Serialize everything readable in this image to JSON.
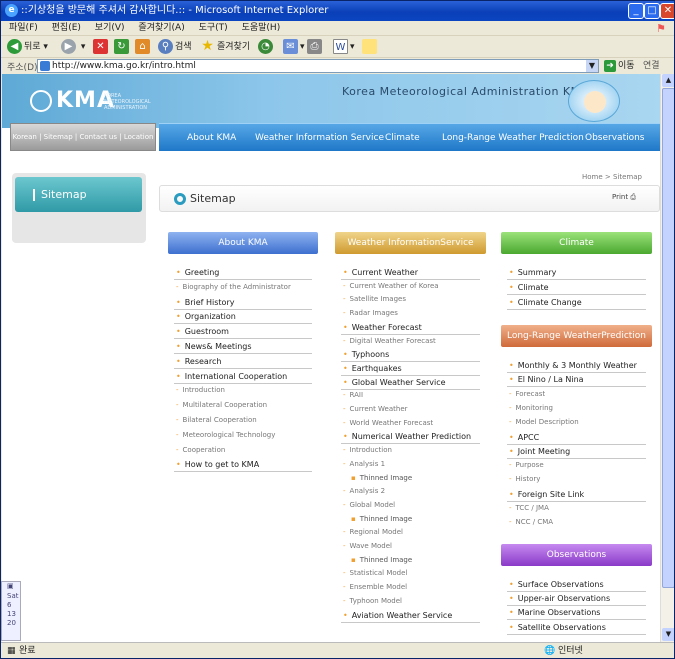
{
  "window": {
    "title": "::기상청을 방문해 주셔서 감사합니다.:: - Microsoft Internet Explorer",
    "controls": [
      "_",
      "□",
      "✕"
    ]
  },
  "menubar": [
    "파일(F)",
    "편집(E)",
    "보기(V)",
    "즐겨찾기(A)",
    "도구(T)",
    "도움말(H)"
  ],
  "toolbar": {
    "back": "뒤로",
    "search": "검색",
    "favorites": "즐겨찾기"
  },
  "address": {
    "label": "주소(D)",
    "url": "http://www.kma.go.kr/intro.html",
    "go": "이동",
    "links": "연결"
  },
  "status": {
    "left": "완료",
    "right": "인터넷"
  },
  "taskbar_fragments": [
    "Sat",
    "6",
    "13",
    "20"
  ],
  "site": {
    "logo": "KMA",
    "logo_sub": "KOREA METEOROLOGICAL ADMINISTRATION",
    "header_title": "Korea Meteorological Administration KMA",
    "side_nav": [
      "Korean",
      "Sitemap",
      "Contact us",
      "Location"
    ],
    "main_nav": [
      "About KMA",
      "Weather Information Service",
      "Climate",
      "Long-Range Weather Prediction",
      "Observations"
    ],
    "sidebar_title": "Sitemap",
    "breadcrumb": "Home > Sitemap",
    "page_title": "Sitemap",
    "print": "Print"
  },
  "sitemap": {
    "about": {
      "header": "About KMA",
      "items": [
        {
          "t": "Greeting",
          "k": "main"
        },
        {
          "t": "Biography of the Administrator",
          "k": "sub"
        },
        {
          "t": "Brief History",
          "k": "main"
        },
        {
          "t": "Organization",
          "k": "main"
        },
        {
          "t": "Guestroom",
          "k": "main"
        },
        {
          "t": "News& Meetings",
          "k": "main"
        },
        {
          "t": "Research",
          "k": "main"
        },
        {
          "t": "International Cooperation",
          "k": "main"
        },
        {
          "t": "Introduction",
          "k": "sub"
        },
        {
          "t": "Multilateral Cooperation",
          "k": "sub"
        },
        {
          "t": "Bilateral Cooperation",
          "k": "sub"
        },
        {
          "t": "Meteorological Technology",
          "k": "sub"
        },
        {
          "t": "Cooperation",
          "k": "sub"
        },
        {
          "t": "How to get to KMA",
          "k": "main"
        }
      ]
    },
    "weather": {
      "header": "Weather InformationService",
      "items": [
        {
          "t": "Current Weather",
          "k": "main"
        },
        {
          "t": "Current Weather of Korea",
          "k": "sub"
        },
        {
          "t": "Satellite Images",
          "k": "sub"
        },
        {
          "t": "Radar Images",
          "k": "sub"
        },
        {
          "t": "Weather Forecast",
          "k": "main"
        },
        {
          "t": "Digital Weather Forecast",
          "k": "sub"
        },
        {
          "t": "Typhoons",
          "k": "main"
        },
        {
          "t": "Earthquakes",
          "k": "main"
        },
        {
          "t": "Global Weather Service",
          "k": "main"
        },
        {
          "t": "RAII",
          "k": "sub"
        },
        {
          "t": "Current Weather",
          "k": "sub"
        },
        {
          "t": "World Weather Forecast",
          "k": "sub"
        },
        {
          "t": "Numerical Weather Prediction",
          "k": "main"
        },
        {
          "t": "Introduction",
          "k": "sub"
        },
        {
          "t": "Analysis 1",
          "k": "sub"
        },
        {
          "t": "Thinned Image",
          "k": "sub2"
        },
        {
          "t": "Analysis 2",
          "k": "sub"
        },
        {
          "t": "Global Model",
          "k": "sub"
        },
        {
          "t": "Thinned Image",
          "k": "sub2"
        },
        {
          "t": "Regional Model",
          "k": "sub"
        },
        {
          "t": "Wave Model",
          "k": "sub"
        },
        {
          "t": "Thinned Image",
          "k": "sub2"
        },
        {
          "t": "Statistical Model",
          "k": "sub"
        },
        {
          "t": "Ensemble Model",
          "k": "sub"
        },
        {
          "t": "Typhoon Model",
          "k": "sub"
        },
        {
          "t": "Aviation Weather Service",
          "k": "main"
        }
      ]
    },
    "climate": {
      "header": "Climate",
      "items": [
        {
          "t": "Summary",
          "k": "main"
        },
        {
          "t": "Climate",
          "k": "main"
        },
        {
          "t": "Climate Change",
          "k": "main"
        }
      ]
    },
    "longrange": {
      "header": "Long-Range WeatherPrediction",
      "items": [
        {
          "t": "Monthly & 3 Monthly Weather",
          "k": "main"
        },
        {
          "t": "El Nino / La Nina",
          "k": "main"
        },
        {
          "t": "Forecast",
          "k": "sub"
        },
        {
          "t": "Monitoring",
          "k": "sub"
        },
        {
          "t": "Model Description",
          "k": "sub"
        },
        {
          "t": "APCC",
          "k": "main"
        },
        {
          "t": "Joint Meeting",
          "k": "main"
        },
        {
          "t": "Purpose",
          "k": "sub"
        },
        {
          "t": "History",
          "k": "sub"
        },
        {
          "t": "Foreign Site Link",
          "k": "main"
        },
        {
          "t": "TCC / JMA",
          "k": "sub"
        },
        {
          "t": "NCC / CMA",
          "k": "sub"
        }
      ]
    },
    "observations": {
      "header": "Observations",
      "items": [
        {
          "t": "Surface Observations",
          "k": "main"
        },
        {
          "t": "Upper-air Observations",
          "k": "main"
        },
        {
          "t": "Marine Observations",
          "k": "main"
        },
        {
          "t": "Satellite Observations",
          "k": "main"
        }
      ]
    }
  }
}
